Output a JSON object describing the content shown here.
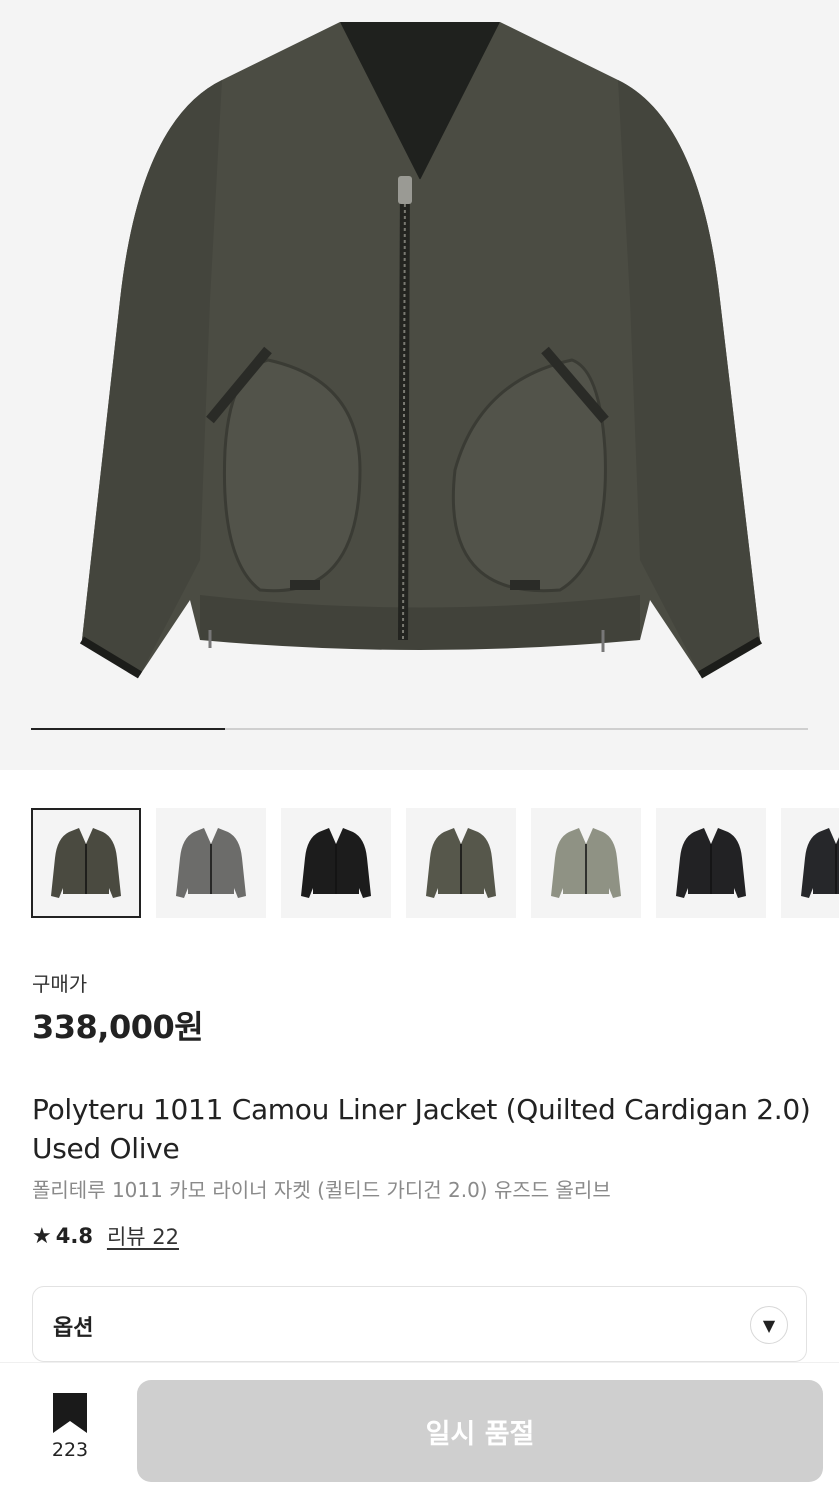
{
  "hero": {
    "image_name": "olive liner jacket product photo",
    "gallery_progress": 0.25
  },
  "thumbnails": [
    {
      "name": "olive-jacket",
      "color": "#4a4a40",
      "selected": true
    },
    {
      "name": "grey-jacket",
      "color": "#6c6c6a",
      "selected": false
    },
    {
      "name": "black-fleece-jacket",
      "color": "#1c1c1c",
      "selected": false
    },
    {
      "name": "olive-zip-jacket",
      "color": "#56574b",
      "selected": false
    },
    {
      "name": "sage-jacket",
      "color": "#8f9284",
      "selected": false
    },
    {
      "name": "black-quilted-jacket",
      "color": "#222224",
      "selected": false
    },
    {
      "name": "black-jacket-partial",
      "color": "#26272a",
      "selected": false
    }
  ],
  "price": {
    "label": "구매가",
    "value": "338,000원"
  },
  "product": {
    "title_en": "Polyteru 1011 Camou Liner Jacket (Quilted Cardigan 2.0) Used Olive",
    "title_ko": "폴리테루 1011 카모 라이너 자켓 (퀼티드 가디건 2.0) 유즈드 올리브",
    "rating": "4.8",
    "review_label": "리뷰 22"
  },
  "option": {
    "label": "옵션",
    "icon": "chevron-down-icon"
  },
  "bottom": {
    "bookmark_icon": "bookmark-icon",
    "bookmark_count": "223",
    "soldout_label": "일시 품절"
  }
}
